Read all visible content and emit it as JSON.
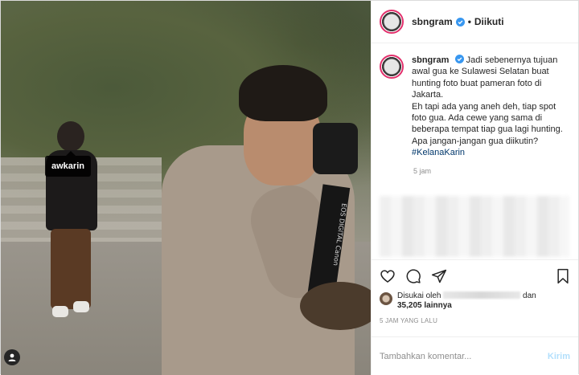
{
  "photo": {
    "tag_label": "awkarin",
    "strap_text": "EOS DIGITAL Canon"
  },
  "header": {
    "username": "sbngram",
    "separator": "•",
    "follow_status": "Diikuti"
  },
  "caption": {
    "username": "sbngram",
    "lines": [
      "Jadi sebenernya tujuan awal gua ke Sulawesi Selatan buat hunting foto buat pameran foto di Jakarta.",
      "Eh tapi ada yang aneh deh, tiap spot foto gua. Ada cewe yang sama di beberapa tempat tiap gua lagi hunting.",
      "Apa jangan-jangan gua diikutin?"
    ],
    "hashtag": "#KelanaKarin",
    "time": "5 jam"
  },
  "likes": {
    "prefix": "Disukai oleh",
    "suffix": "dan",
    "count": "35,205",
    "count_suffix": "lainnya"
  },
  "post_time": "5 JAM YANG LALU",
  "comment": {
    "placeholder": "Tambahkan komentar...",
    "submit_label": "Kirim"
  },
  "colors": {
    "verified": "#3897f0",
    "link": "#00376b",
    "muted": "#8e8e8e",
    "submit_disabled": "#b2dffc"
  }
}
